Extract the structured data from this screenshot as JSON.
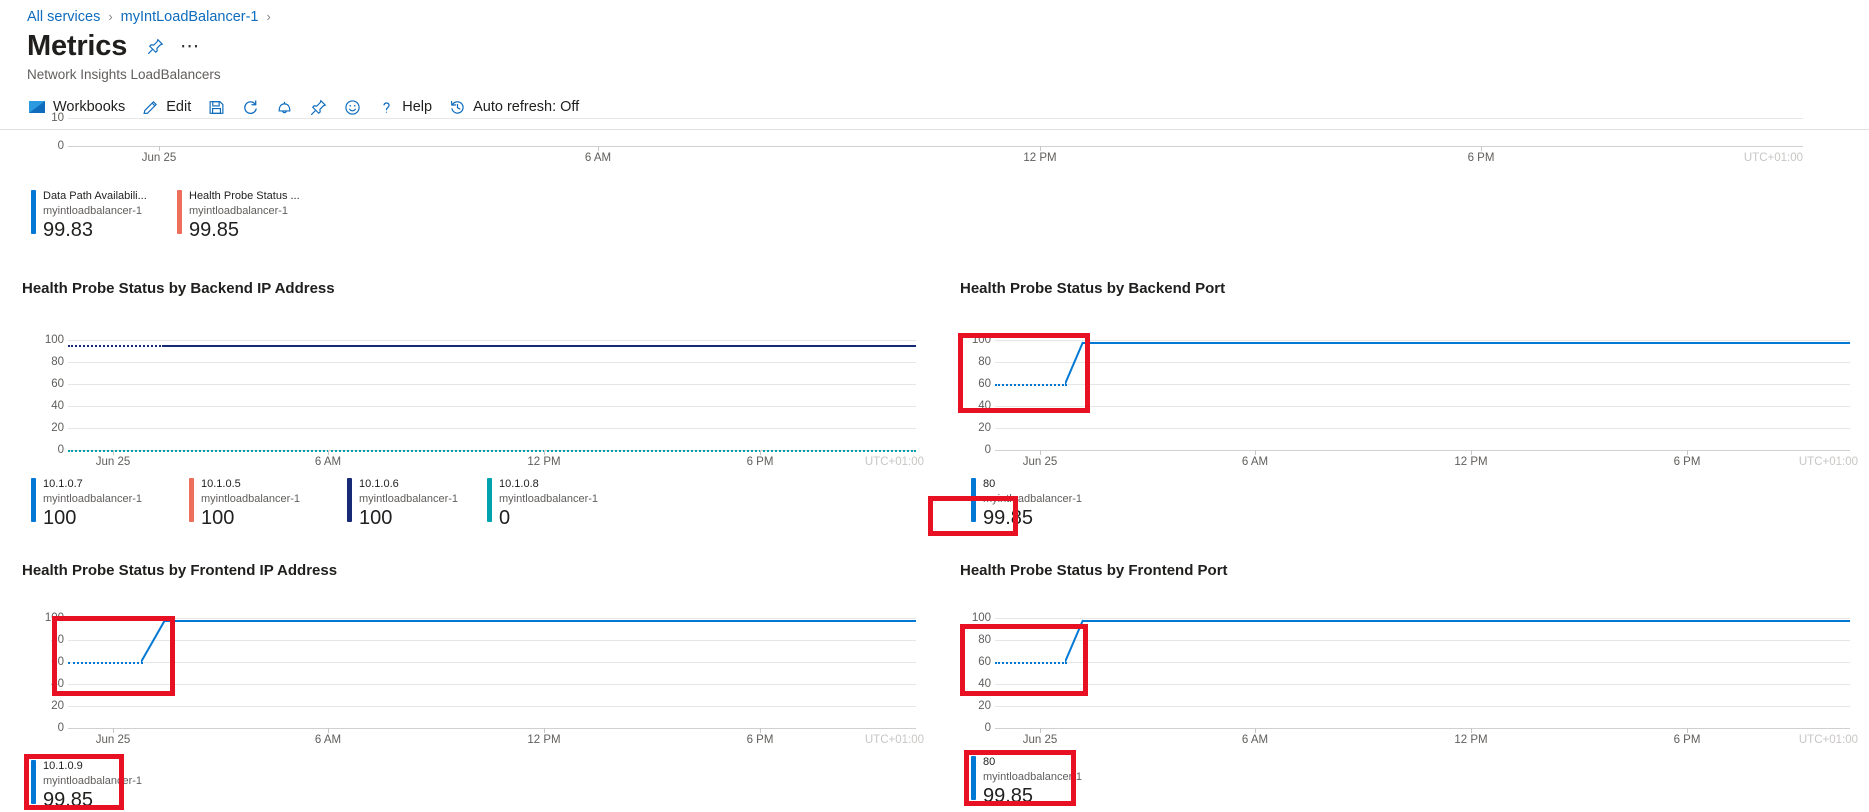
{
  "breadcrumb": {
    "items": [
      {
        "label": "All services",
        "icon": "chevron-right-icon"
      },
      {
        "label": "myIntLoadBalancer-1",
        "icon": "chevron-right-icon"
      }
    ],
    "separator": "›"
  },
  "header": {
    "title": "Metrics",
    "subtitle": "Network Insights LoadBalancers",
    "pin_icon": "pin-icon",
    "more_label": "⋯"
  },
  "toolbar": {
    "items": [
      {
        "name": "workbooks",
        "label": "Workbooks",
        "icon": "workbooks-icon"
      },
      {
        "name": "edit",
        "label": "Edit",
        "icon": "pencil-icon"
      },
      {
        "name": "save",
        "label": "",
        "icon": "save-icon"
      },
      {
        "name": "refresh",
        "label": "",
        "icon": "refresh-icon"
      },
      {
        "name": "alert",
        "label": "",
        "icon": "bell-icon"
      },
      {
        "name": "pin",
        "label": "",
        "icon": "pin-icon"
      },
      {
        "name": "feedback",
        "label": "",
        "icon": "smiley-icon"
      },
      {
        "name": "help",
        "label": "Help",
        "icon": "question-icon"
      },
      {
        "name": "auto-refresh",
        "label": "Auto refresh: Off",
        "icon": "clock-history-icon"
      }
    ]
  },
  "colors": {
    "accent_blue": "#0f6cbd",
    "series_blue": "#0078d4",
    "series_red": "#ec6e5b",
    "series_navy": "#162a77",
    "series_teal": "#00a2ad",
    "annotation_red": "#e81123",
    "grid": "#e6e6e6",
    "axis_text": "#605e5c"
  },
  "charts": [
    {
      "id": "summary",
      "title": "",
      "partial_top": true,
      "yticks": [
        "10",
        "0"
      ],
      "xticks": [
        "Jun 25",
        "6 AM",
        "12 PM",
        "6 PM"
      ],
      "timezone": "UTC+01:00",
      "legend": [
        {
          "name": "Data Path Availabili...",
          "sub": "myintloadbalancer-1",
          "value": "99.83",
          "color": "#0078d4"
        },
        {
          "name": "Health Probe Status ...",
          "sub": "myintloadbalancer-1",
          "value": "99.85",
          "color": "#ec6e5b"
        }
      ]
    },
    {
      "id": "backend-ip",
      "title": "Health Probe Status by Backend IP Address",
      "yticks": [
        "100",
        "80",
        "60",
        "40",
        "20",
        "0"
      ],
      "xticks": [
        "Jun 25",
        "6 AM",
        "12 PM",
        "6 PM"
      ],
      "timezone": "UTC+01:00",
      "legend": [
        {
          "name": "10.1.0.7",
          "sub": "myintloadbalancer-1",
          "value": "100",
          "color": "#0078d4"
        },
        {
          "name": "10.1.0.5",
          "sub": "myintloadbalancer-1",
          "value": "100",
          "color": "#ec6e5b"
        },
        {
          "name": "10.1.0.6",
          "sub": "myintloadbalancer-1",
          "value": "100",
          "color": "#162a77"
        },
        {
          "name": "10.1.0.8",
          "sub": "myintloadbalancer-1",
          "value": "0",
          "color": "#00a2ad"
        }
      ]
    },
    {
      "id": "backend-port",
      "title": "Health Probe Status by Backend Port",
      "yticks": [
        "100",
        "80",
        "60",
        "40",
        "20",
        "0"
      ],
      "xticks": [
        "Jun 25",
        "6 AM",
        "12 PM",
        "6 PM"
      ],
      "timezone": "UTC+01:00",
      "legend": [
        {
          "name": "80",
          "sub": "myintloadbalancer-1",
          "value": "99.85",
          "color": "#0078d4"
        }
      ]
    },
    {
      "id": "frontend-ip",
      "title": "Health Probe Status by Frontend IP Address",
      "yticks": [
        "100",
        "80",
        "60",
        "40",
        "20",
        "0"
      ],
      "xticks": [
        "Jun 25",
        "6 AM",
        "12 PM",
        "6 PM"
      ],
      "timezone": "UTC+01:00",
      "legend": [
        {
          "name": "10.1.0.9",
          "sub": "myintloadbalancer-1",
          "value": "99.85",
          "color": "#0078d4"
        }
      ]
    },
    {
      "id": "frontend-port",
      "title": "Health Probe Status by Frontend Port",
      "yticks": [
        "100",
        "80",
        "60",
        "40",
        "20",
        "0"
      ],
      "xticks": [
        "Jun 25",
        "6 AM",
        "12 PM",
        "6 PM"
      ],
      "timezone": "UTC+01:00",
      "legend": [
        {
          "name": "80",
          "sub": "myintloadbalancer-1",
          "value": "99.85",
          "color": "#0078d4"
        }
      ]
    }
  ],
  "chart_data": [
    {
      "type": "line",
      "id": "summary",
      "title": "",
      "xlabel": "",
      "ylabel": "",
      "ylim": [
        0,
        10
      ],
      "yticks": [
        0,
        10
      ],
      "x": [
        "Jun 25",
        "6 AM",
        "12 PM",
        "6 PM"
      ],
      "grid": true,
      "legend_position": "bottom",
      "note": "Only bottom portion of plot visible (scrolled); series lines above viewport",
      "series": [
        {
          "name": "Data Path Availability myintloadbalancer-1",
          "value": 99.83,
          "color": "#0078d4"
        },
        {
          "name": "Health Probe Status myintloadbalancer-1",
          "value": 99.85,
          "color": "#ec6e5b"
        }
      ]
    },
    {
      "type": "line",
      "id": "backend-ip",
      "title": "Health Probe Status by Backend IP Address",
      "xlabel": "",
      "ylabel": "",
      "ylim": [
        0,
        100
      ],
      "yticks": [
        0,
        20,
        40,
        60,
        80,
        100
      ],
      "x": [
        "Jun 25",
        "6 AM",
        "12 PM",
        "6 PM"
      ],
      "grid": true,
      "legend_position": "bottom",
      "series": [
        {
          "name": "10.1.0.7",
          "sub": "myintloadbalancer-1",
          "value": 100,
          "color": "#0078d4",
          "style": "flat-100"
        },
        {
          "name": "10.1.0.5",
          "sub": "myintloadbalancer-1",
          "value": 100,
          "color": "#ec6e5b",
          "style": "flat-100"
        },
        {
          "name": "10.1.0.6",
          "sub": "myintloadbalancer-1",
          "value": 100,
          "color": "#162a77",
          "style": "flat-100-dotted-then-solid"
        },
        {
          "name": "10.1.0.8",
          "sub": "myintloadbalancer-1",
          "value": 0,
          "color": "#00a2ad",
          "style": "flat-0-dotted"
        }
      ]
    },
    {
      "type": "line",
      "id": "backend-port",
      "title": "Health Probe Status by Backend Port",
      "xlabel": "",
      "ylabel": "",
      "ylim": [
        0,
        100
      ],
      "yticks": [
        0,
        20,
        40,
        60,
        80,
        100
      ],
      "x": [
        "Jun 25",
        "6 AM",
        "12 PM",
        "6 PM"
      ],
      "grid": true,
      "legend_position": "bottom",
      "annotation": "red rectangle highlighting early ramp from 60 to 100 near Jun 25",
      "series": [
        {
          "name": "80",
          "sub": "myintloadbalancer-1",
          "value": 99.85,
          "color": "#0078d4",
          "style": "dotted-60-ramp-to-100"
        }
      ]
    },
    {
      "type": "line",
      "id": "frontend-ip",
      "title": "Health Probe Status by Frontend IP Address",
      "xlabel": "",
      "ylabel": "",
      "ylim": [
        0,
        100
      ],
      "yticks": [
        0,
        20,
        40,
        60,
        80,
        100
      ],
      "x": [
        "Jun 25",
        "6 AM",
        "12 PM",
        "6 PM"
      ],
      "grid": true,
      "legend_position": "bottom",
      "annotation": "red rectangle highlighting early ramp from 60 to 100 near Jun 25",
      "series": [
        {
          "name": "10.1.0.9",
          "sub": "myintloadbalancer-1",
          "value": 99.85,
          "color": "#0078d4",
          "style": "dotted-60-ramp-to-100"
        }
      ]
    },
    {
      "type": "line",
      "id": "frontend-port",
      "title": "Health Probe Status by Frontend Port",
      "xlabel": "",
      "ylabel": "",
      "ylim": [
        0,
        100
      ],
      "yticks": [
        0,
        20,
        40,
        60,
        80,
        100
      ],
      "x": [
        "Jun 25",
        "6 AM",
        "12 PM",
        "6 PM"
      ],
      "grid": true,
      "legend_position": "bottom",
      "annotation": "red rectangle highlighting early ramp from 60 to 100 near Jun 25",
      "series": [
        {
          "name": "80",
          "sub": "myintloadbalancer-1",
          "value": 99.85,
          "color": "#0078d4",
          "style": "dotted-60-ramp-to-100"
        }
      ]
    }
  ]
}
